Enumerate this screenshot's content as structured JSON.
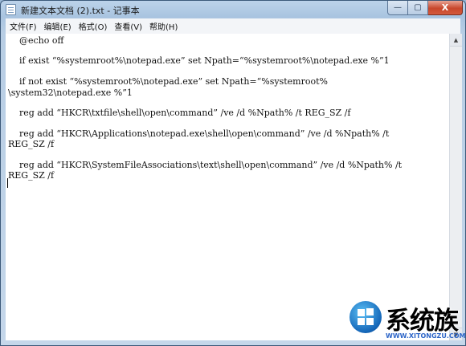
{
  "window": {
    "title": "新建文本文档 (2).txt - 记事本",
    "controls": {
      "minimize": "—",
      "maximize": "▢",
      "close": "X"
    }
  },
  "menubar": {
    "items": [
      {
        "label": "文件(F)"
      },
      {
        "label": "编辑(E)"
      },
      {
        "label": "格式(O)"
      },
      {
        "label": "查看(V)"
      },
      {
        "label": "帮助(H)"
      }
    ]
  },
  "editor": {
    "lines": [
      "    @echo off",
      "    if exist “%systemroot%\\notepad.exe” set Npath=“%systemroot%\\notepad.exe %”1",
      "    if not exist “%systemroot%\\notepad.exe” set Npath=“%systemroot%",
      "\\system32\\notepad.exe %”1",
      "    reg add “HKCR\\txtfile\\shell\\open\\command” /ve /d %Npath% /t REG_SZ /f",
      "    reg add “HKCR\\Applications\\notepad.exe\\shell\\open\\command” /ve /d %Npath% /t",
      "REG_SZ /f",
      "    reg add “HKCR\\SystemFileAssociations\\text\\shell\\open\\command” /ve /d %Npath% /t",
      "REG_SZ /f"
    ]
  },
  "scrollbar": {
    "up_icon": "▲",
    "down_icon": "▼"
  },
  "watermark": {
    "name": "系统族",
    "url": "WWW.XITONGZU.COM"
  },
  "colors": {
    "title_bar": "#a9c4e0",
    "close_button": "#c8472c",
    "watermark_url": "#2e66c8"
  }
}
